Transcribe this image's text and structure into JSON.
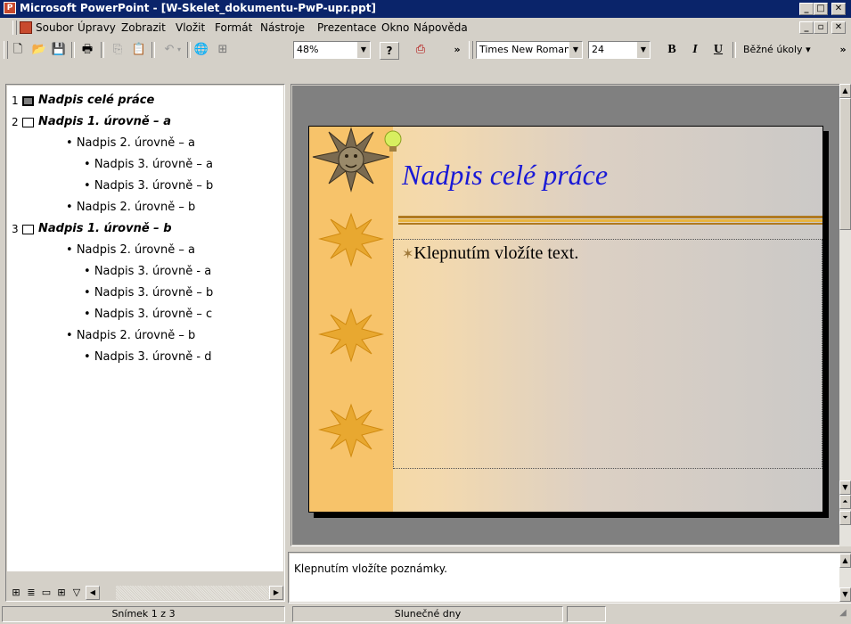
{
  "window": {
    "title": "Microsoft PowerPoint - [W-Skelet_dokumentu-PwP-upr.ppt]",
    "app_icon": "powerpoint-icon"
  },
  "menu": {
    "items": [
      "Soubor",
      "Úpravy",
      "Zobrazit",
      "Vložit",
      "Formát",
      "Nástroje",
      "Prezentace",
      "Okno",
      "Nápověda"
    ]
  },
  "toolbar": {
    "zoom": "48%",
    "chevron": "»",
    "font_name": "Times New Roman",
    "font_size": "24",
    "bold": "B",
    "italic": "I",
    "underline": "U",
    "common_tasks": "Běžné úkoly ▾",
    "icons": [
      "new-icon",
      "open-icon",
      "save-icon",
      "print-icon",
      "copy-icon",
      "paste-icon",
      "undo-icon",
      "insert-hyperlink-icon",
      "table-icon",
      "help-icon",
      "pdf-icon"
    ]
  },
  "outline": {
    "slides": [
      {
        "num": "1",
        "title": "Nadpis celé práce",
        "items": []
      },
      {
        "num": "2",
        "title": "Nadpis 1. úrovně – a",
        "items": [
          {
            "level": 2,
            "text": "Nadpis 2. úrovně – a"
          },
          {
            "level": 3,
            "text": "Nadpis 3. úrovně – a"
          },
          {
            "level": 3,
            "text": "Nadpis 3. úrovně – b"
          },
          {
            "level": 2,
            "text": "Nadpis 2. úrovně – b"
          }
        ]
      },
      {
        "num": "3",
        "title": "Nadpis 1. úrovně – b",
        "items": [
          {
            "level": 2,
            "text": "Nadpis 2. úrovně – a"
          },
          {
            "level": 3,
            "text": "Nadpis 3. úrovně - a"
          },
          {
            "level": 3,
            "text": "Nadpis 3. úrovně – b"
          },
          {
            "level": 3,
            "text": "Nadpis 3. úrovně – c"
          },
          {
            "level": 2,
            "text": "Nadpis 2. úrovně – b"
          },
          {
            "level": 3,
            "text": "Nadpis 3. úrovně - d"
          }
        ]
      }
    ]
  },
  "slide": {
    "title": "Nadpis celé práce",
    "body_placeholder": "Klepnutím vložíte text.",
    "bullet": "✶"
  },
  "notes": {
    "placeholder": "Klepnutím vložíte poznámky."
  },
  "status": {
    "slide_position": "Snímek 1 z 3",
    "design": "Slunečné dny"
  }
}
